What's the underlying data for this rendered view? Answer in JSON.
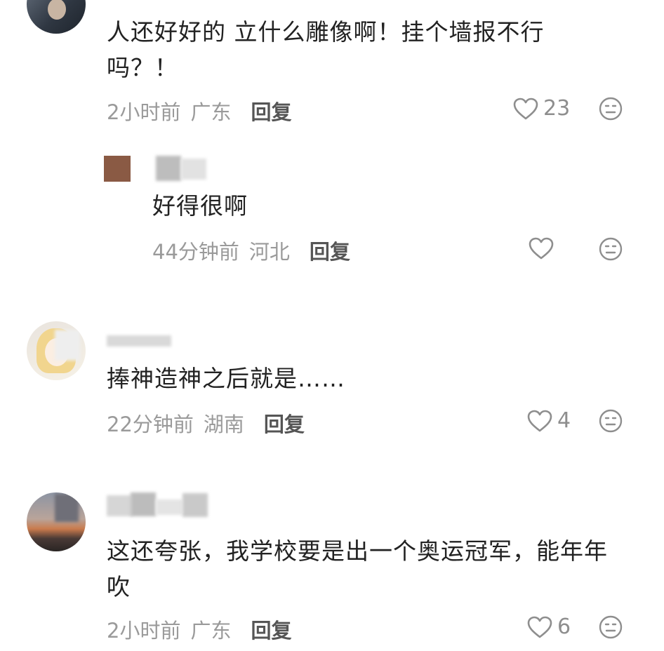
{
  "comments": [
    {
      "text": "人还好好的 立什么雕像啊！挂个墙报不行吗？！",
      "time": "2小时前",
      "location": "广东",
      "reply_label": "回复",
      "likes": "23",
      "avatar_icon": "man-in-car-avatar"
    },
    {
      "text": "好得很啊",
      "time": "44分钟前",
      "location": "河北",
      "reply_label": "回复",
      "likes": "",
      "avatar_icon": "brown-square-avatar"
    },
    {
      "text": "捧神造神之后就是……",
      "time": "22分钟前",
      "location": "湖南",
      "reply_label": "回复",
      "likes": "4",
      "avatar_icon": "anime-girl-avatar"
    },
    {
      "text": "这还夸张，我学校要是出一个奥运冠军，能年年吹",
      "time": "2小时前",
      "location": "广东",
      "reply_label": "回复",
      "likes": "6",
      "avatar_icon": "sunset-landscape-avatar"
    }
  ],
  "icons": {
    "like": "heart-outline-icon",
    "dislike": "neutral-face-icon"
  },
  "colors": {
    "text": "#222222",
    "meta": "#9a9a9a",
    "reply": "#555555",
    "icon": "#8e8e8e",
    "background": "#ffffff"
  }
}
